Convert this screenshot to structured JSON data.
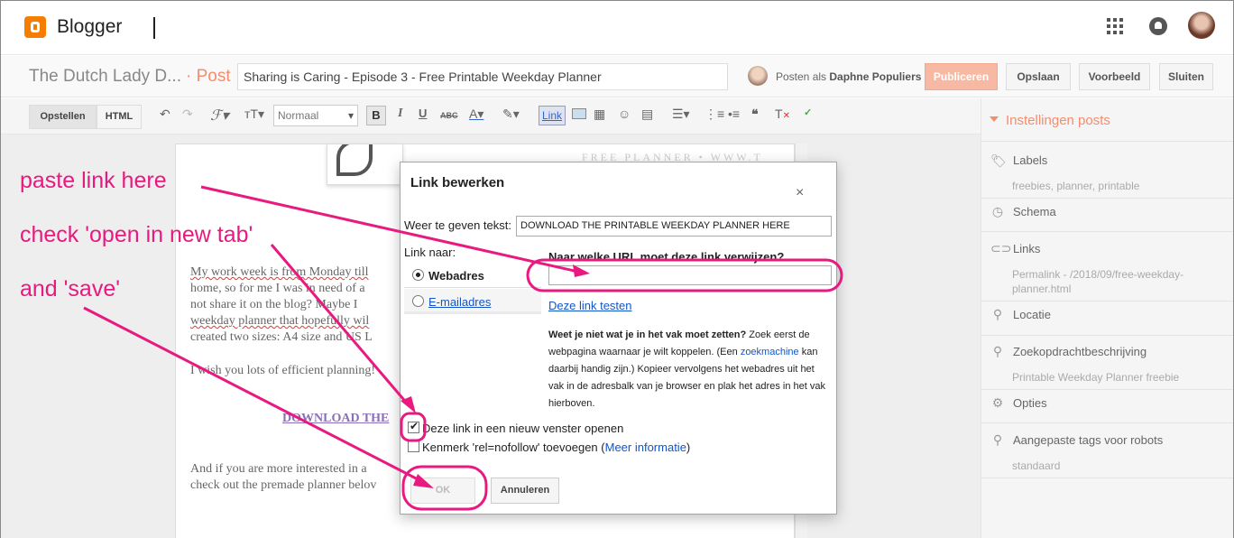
{
  "app": {
    "name": "Blogger"
  },
  "postbar": {
    "blog_name": "The Dutch Lady D...",
    "post_word": "· Post",
    "title_value": "Sharing is Caring - Episode 3 - Free Printable Weekday Planner",
    "posting_as_prefix": "Posten als",
    "posting_as_user": "Daphne Populiers",
    "publish": "Publiceren",
    "save": "Opslaan",
    "preview": "Voorbeeld",
    "close": "Sluiten"
  },
  "toolbar": {
    "mode_compose": "Opstellen",
    "mode_html": "HTML",
    "font_size": "Normaal",
    "bold": "B",
    "italic": "I",
    "underline": "U",
    "strike": "ABC",
    "link": "Link"
  },
  "editor": {
    "image_caption": "FREE PLANNER • WWW.T",
    "lines": [
      "My work week is from Monday till",
      "home, so for me I was in need of a",
      "not share it on the blog? Maybe I",
      "weekday planner that hopefully wil",
      "created two sizes: A4 size and US L"
    ],
    "wish": "I wish you lots of efficient planning!",
    "download": "DOWNLOAD THE",
    "bottom_lines": [
      "And if you are more interested in a",
      "check out the premade planner belov"
    ]
  },
  "sidebar": {
    "title": "Instellingen posts",
    "sections": [
      {
        "icon": "tag-icon",
        "label": "Labels",
        "value": "freebies, planner, printable"
      },
      {
        "icon": "clock-icon",
        "label": "Schema",
        "value": ""
      },
      {
        "icon": "link-icon",
        "label": "Links",
        "value": "Permalink - /2018/09/free-weekday-planner.html"
      },
      {
        "icon": "location-icon",
        "label": "Locatie",
        "value": ""
      },
      {
        "icon": "search-icon",
        "label": "Zoekopdrachtbeschrijving",
        "value": "Printable Weekday Planner freebie"
      },
      {
        "icon": "gear-icon",
        "label": "Opties",
        "value": ""
      },
      {
        "icon": "search-icon",
        "label": "Aangepaste tags voor robots",
        "value": "standaard"
      }
    ],
    "permalink_line1": "Permalink - /2018/09/free-weekday-",
    "permalink_line2": "planner.html"
  },
  "dialog": {
    "title": "Link bewerken",
    "close": "×",
    "text_label": "Weer te geven tekst:",
    "text_value": "DOWNLOAD THE PRINTABLE WEEKDAY PLANNER HERE",
    "link_to": "Link naar:",
    "tab_web": "Webadres",
    "tab_mail": "E-mailadres",
    "url_question": "Naar welke URL moet deze link verwijzen?",
    "url_value": "",
    "test_link": "Deze link testen",
    "help_bold": "Weet je niet wat je in het vak moet zetten?",
    "help_1": " Zoek eerst de webpagina waarnaar je wilt koppelen. (Een ",
    "help_link": "zoekmachine",
    "help_2": " kan daarbij handig zijn.) Kopieer vervolgens het webadres uit het vak in de adresbalk van je browser en plak het adres in het vak hierboven.",
    "new_window": "Deze link in een nieuw venster openen",
    "new_window_checked": true,
    "nofollow_prefix": "Kenmerk 'rel=nofollow' toevoegen (",
    "nofollow_link": "Meer informatie",
    "nofollow_suffix": ")",
    "ok": "OK",
    "cancel": "Annuleren"
  },
  "annotations": {
    "paste": "paste link here",
    "check": "check 'open in new tab'",
    "save": "and 'save'",
    "color": "#e8197f"
  }
}
